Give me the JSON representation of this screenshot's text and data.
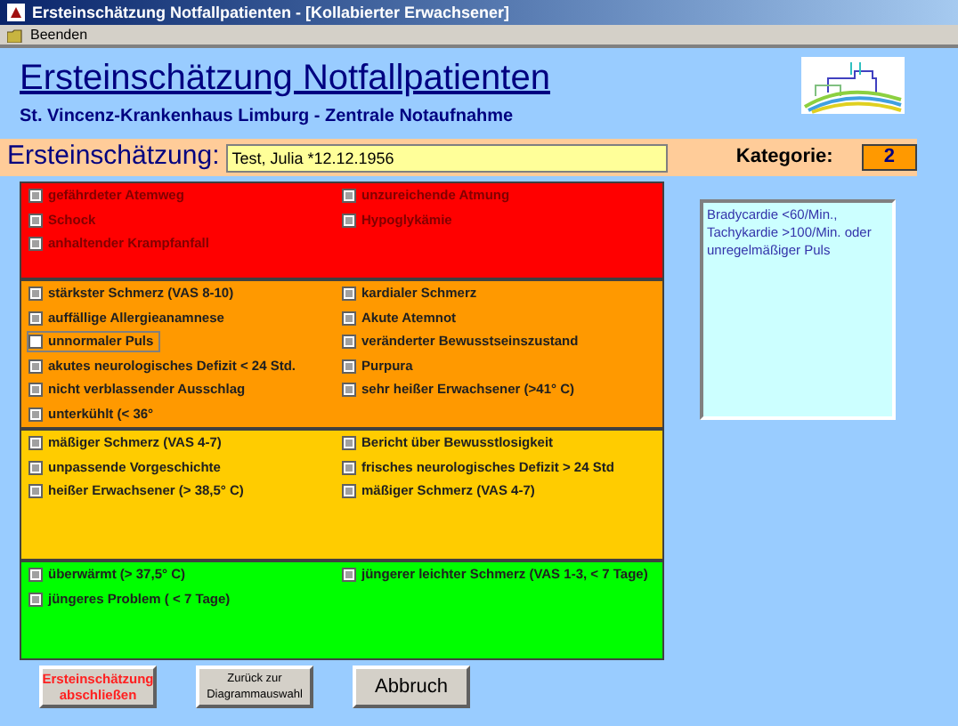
{
  "window": {
    "title": "Ersteinschätzung Notfallpatienten - [Kollabierter Erwachsener]"
  },
  "toolbar": {
    "items": [
      {
        "label": "Beenden"
      }
    ]
  },
  "header": {
    "title": "Ersteinschätzung Notfallpatienten",
    "subtitle": "St. Vincenz-Krankenhaus Limburg - Zentrale Notaufnahme"
  },
  "patient_bar": {
    "label": "Ersteinschätzung:",
    "value": "Test, Julia *12.12.1956",
    "category_label": "Kategorie:",
    "category": "2"
  },
  "sections": [
    {
      "color": "#ff0000",
      "items": [
        {
          "label": "gefährdeter Atemweg",
          "greyed": true,
          "focused": false
        },
        {
          "label": "unzureichende Atmung",
          "greyed": true,
          "focused": false
        },
        {
          "label": "Schock",
          "greyed": true,
          "focused": false
        },
        {
          "label": "Hypoglykämie",
          "greyed": true,
          "focused": false
        },
        {
          "label": "anhaltender Krampfanfall",
          "greyed": true,
          "focused": false
        }
      ]
    },
    {
      "color": "#ff9900",
      "items": [
        {
          "label": "stärkster Schmerz (VAS 8-10)",
          "greyed": true,
          "focused": false
        },
        {
          "label": "kardialer Schmerz",
          "greyed": true,
          "focused": false
        },
        {
          "label": "auffällige Allergieanamnese",
          "greyed": true,
          "focused": false
        },
        {
          "label": "Akute Atemnot",
          "greyed": true,
          "focused": false
        },
        {
          "label": "unnormaler Puls",
          "greyed": false,
          "focused": true
        },
        {
          "label": "veränderter Bewusstseinszustand",
          "greyed": true,
          "focused": false
        },
        {
          "label": "akutes neurologisches Defizit < 24 Std.",
          "greyed": true,
          "focused": false
        },
        {
          "label": "Purpura",
          "greyed": true,
          "focused": false
        },
        {
          "label": "nicht verblassender Ausschlag",
          "greyed": true,
          "focused": false
        },
        {
          "label": "sehr heißer Erwachsener (>41° C)",
          "greyed": true,
          "focused": false
        },
        {
          "label": "unterkühlt (< 36°",
          "greyed": true,
          "focused": false
        }
      ]
    },
    {
      "color": "#ffcc00",
      "items": [
        {
          "label": "mäßiger Schmerz (VAS 4-7)",
          "greyed": true,
          "focused": false
        },
        {
          "label": "Bericht über Bewusstlosigkeit",
          "greyed": true,
          "focused": false
        },
        {
          "label": "unpassende Vorgeschichte",
          "greyed": true,
          "focused": false
        },
        {
          "label": "frisches neurologisches Defizit > 24 Std",
          "greyed": true,
          "focused": false
        },
        {
          "label": "heißer Erwachsener (> 38,5° C)",
          "greyed": true,
          "focused": false
        },
        {
          "label": "mäßiger Schmerz (VAS 4-7)",
          "greyed": true,
          "focused": false
        }
      ]
    },
    {
      "color": "#00ff00",
      "items": [
        {
          "label": "überwärmt (> 37,5° C)",
          "greyed": true,
          "focused": false
        },
        {
          "label": "jüngerer leichter Schmerz (VAS 1-3, < 7 Tage)",
          "greyed": true,
          "focused": false
        },
        {
          "label": "jüngeres Problem ( < 7 Tage)",
          "greyed": true,
          "focused": false
        }
      ]
    }
  ],
  "info_box": {
    "text": "Bradycardie <60/Min., Tachykardie >100/Min. oder unregelmäßiger Puls"
  },
  "buttons": [
    {
      "label": "Ersteinschätzung abschließen",
      "kind": "primary"
    },
    {
      "label": "Zurück zur Diagrammauswahl",
      "kind": "small"
    },
    {
      "label": "Abbruch",
      "kind": "large"
    }
  ]
}
